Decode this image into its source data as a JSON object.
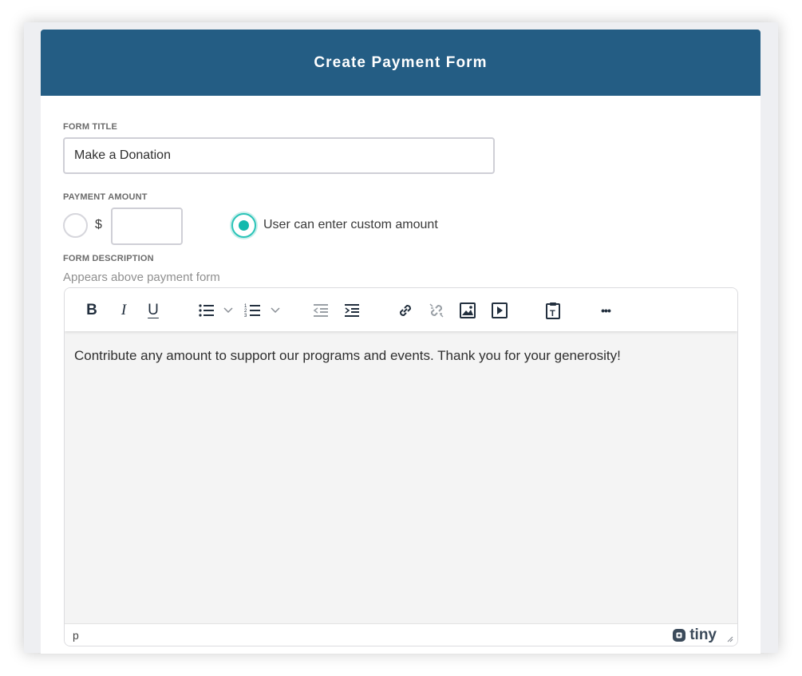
{
  "dialog": {
    "title": "Create Payment Form"
  },
  "form_title": {
    "label": "FORM TITLE",
    "value": "Make a Donation"
  },
  "payment_amount": {
    "label": "PAYMENT AMOUNT",
    "currency_symbol": "$",
    "amount_value": "",
    "fixed_selected": false,
    "custom_selected": true,
    "custom_label": "User can enter custom amount"
  },
  "form_description": {
    "label": "FORM DESCRIPTION",
    "help": "Appears above payment form"
  },
  "editor": {
    "toolbar": [
      {
        "name": "bold-icon",
        "glyph": "B"
      },
      {
        "name": "italic-icon",
        "glyph": "I"
      },
      {
        "name": "underline-icon",
        "glyph": "U"
      },
      {
        "name": "bullet-list-icon"
      },
      {
        "name": "numbered-list-icon"
      },
      {
        "name": "outdent-icon"
      },
      {
        "name": "indent-icon"
      },
      {
        "name": "link-icon"
      },
      {
        "name": "unlink-icon"
      },
      {
        "name": "image-icon"
      },
      {
        "name": "media-icon"
      },
      {
        "name": "paste-text-icon"
      },
      {
        "name": "more-icon",
        "glyph": "•••"
      }
    ],
    "content": "Contribute any amount to support our programs and events. Thank you for your generosity!",
    "status_path": "p",
    "brand": "tiny"
  },
  "colors": {
    "header": "#245d84",
    "accent": "#13b9ad",
    "toolbar_icon": "#222f3e"
  }
}
